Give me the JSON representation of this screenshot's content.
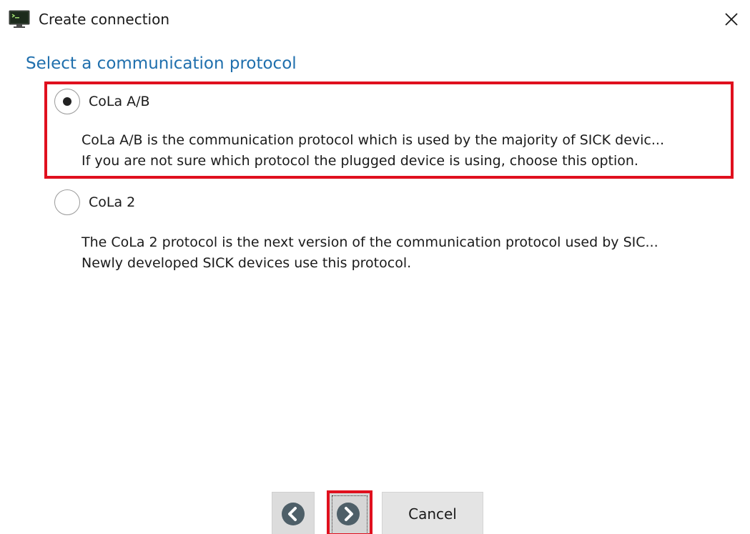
{
  "window": {
    "title": "Create connection",
    "app_icon": "terminal-monitor-icon",
    "close_icon": "close-icon"
  },
  "heading": "Select a communication protocol",
  "options": [
    {
      "label": "CoLa A/B",
      "selected": true,
      "description": [
        "CoLa A/B is the communication protocol which is used by the majority of SICK devic...",
        "If you are not sure which protocol the plugged device is using, choose this option."
      ]
    },
    {
      "label": "CoLa 2",
      "selected": false,
      "description": [
        "The CoLa 2 protocol is the next version of the communication protocol used by SIC...",
        "Newly developed SICK devices use this protocol."
      ]
    }
  ],
  "buttons": {
    "back_icon": "chevron-left-circle-icon",
    "next_icon": "chevron-right-circle-icon",
    "cancel": "Cancel"
  },
  "colors": {
    "accent": "#1f6fad",
    "highlight": "#e0101e"
  }
}
